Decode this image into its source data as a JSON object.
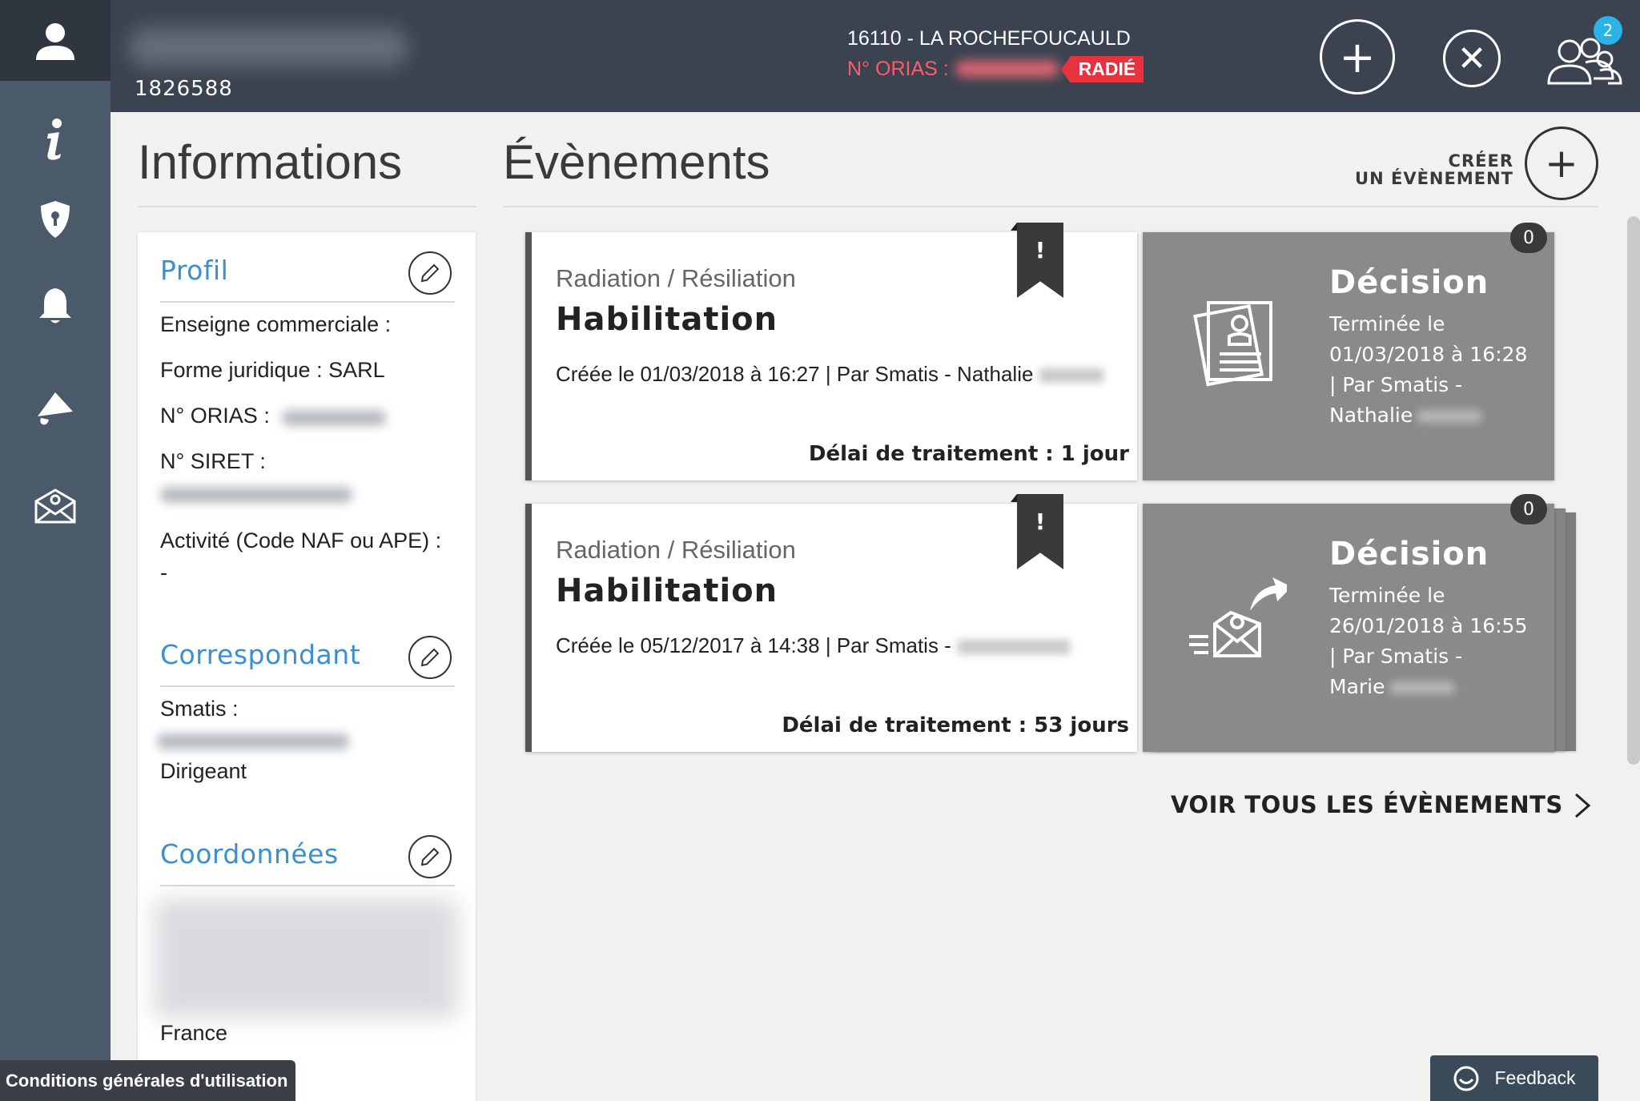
{
  "header": {
    "user_id": "1826588",
    "location": "16110 - LA ROCHEFOUCAULD",
    "orias_label": "N° ORIAS :",
    "status_badge": "RADIÉ",
    "notifications_count": "2"
  },
  "sidebar": {
    "items": [
      "user-icon",
      "info-icon",
      "shield-icon",
      "bell-icon",
      "megaphone-icon",
      "mail-icon"
    ]
  },
  "info": {
    "title": "Informations",
    "profil": {
      "title": "Profil",
      "enseigne": "Enseigne commerciale :",
      "forme": "Forme juridique : SARL",
      "orias": "N° ORIAS :",
      "siret": "N° SIRET :",
      "activite": "Activité (Code NAF ou APE) :",
      "activite_value": "-"
    },
    "correspondant": {
      "title": "Correspondant",
      "smatis": "Smatis :",
      "role": "Dirigeant"
    },
    "coordonnees": {
      "title": "Coordonnées",
      "country": "France"
    }
  },
  "events": {
    "title": "Évènements",
    "create_line1": "CRÉER",
    "create_line2": "UN ÉVÈNEMENT",
    "see_all": "VOIR TOUS LES ÉVÈNEMENTS",
    "items": [
      {
        "category": "Radiation / Résiliation",
        "name": "Habilitation",
        "created": "Créée le 01/03/2018 à 16:27 | Par Smatis - Nathalie",
        "delay": "Délai de traitement : 1 jour",
        "flag": "!",
        "decision": {
          "title": "Décision",
          "line1": "Terminée le",
          "line2": "01/03/2018 à 16:28",
          "line3": "| Par Smatis -",
          "line4": "Nathalie",
          "count": "0",
          "icon": "document-badge-icon"
        }
      },
      {
        "category": "Radiation / Résiliation",
        "name": "Habilitation",
        "created": "Créée le 05/12/2017 à 14:38 | Par Smatis -",
        "delay": "Délai de traitement : 53 jours",
        "flag": "!",
        "decision": {
          "title": "Décision",
          "line1": "Terminée le",
          "line2": "26/01/2018 à 16:55",
          "line3": "| Par Smatis -",
          "line4": "Marie",
          "count": "0",
          "icon": "email-send-icon"
        }
      }
    ]
  },
  "footer": {
    "cgu": "Conditions générales d'utilisation",
    "feedback": "Feedback"
  },
  "colors": {
    "header_bg": "#3b4350",
    "sidebar_bg": "#4a5a6a",
    "accent_blue": "#3a8fd1",
    "status_red": "#e8323f",
    "decision_bg": "#8a8a8a"
  }
}
